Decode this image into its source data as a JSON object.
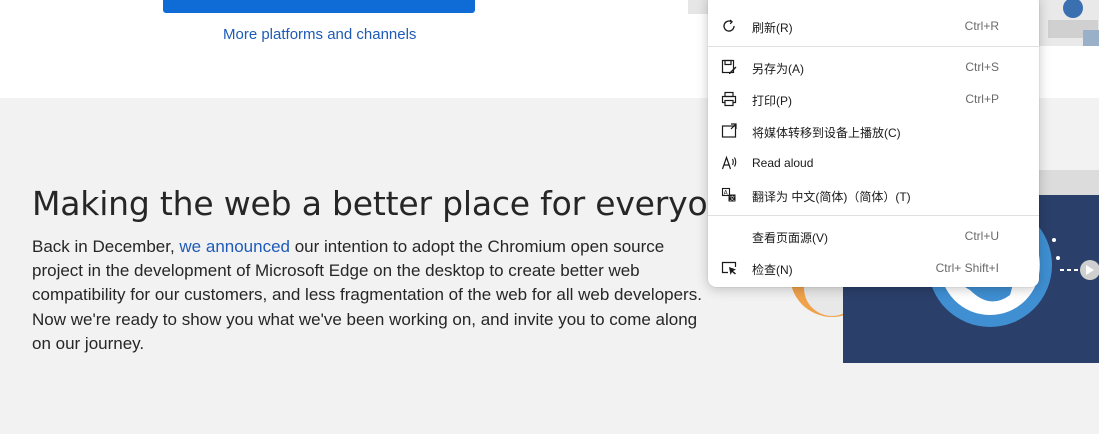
{
  "hero": {
    "more_link": "More platforms and channels"
  },
  "section": {
    "headline": "Making the web a better place for everyone",
    "body_before": "Back in December, ",
    "body_link": "we announced",
    "body_after": " our intention to adopt the Chromium open source project in the development of Microsoft Edge on the desktop to create better web compatibility for our customers, and less fragmentation of the web for all web developers. Now we're ready to show you what we've been working on, and invite you to come along on our journey."
  },
  "context_menu": {
    "items": [
      {
        "label": "刷新(R)",
        "shortcut": "Ctrl+R",
        "icon": "refresh-icon"
      },
      {
        "label": "另存为(A)",
        "shortcut": "Ctrl+S",
        "icon": "save-as-icon"
      },
      {
        "label": "打印(P)",
        "shortcut": "Ctrl+P",
        "icon": "print-icon"
      },
      {
        "label": "将媒体转移到设备上播放(C)",
        "shortcut": "",
        "icon": "cast-media-icon"
      },
      {
        "label": "Read aloud",
        "shortcut": "",
        "icon": "read-aloud-icon"
      },
      {
        "label": "翻译为 中文(简体)（简体）(T)",
        "shortcut": "",
        "icon": "translate-icon"
      },
      {
        "label": "查看页面源(V)",
        "shortcut": "Ctrl+U",
        "icon": ""
      },
      {
        "label": "检查(N)",
        "shortcut": "Ctrl+ Shift+I",
        "icon": "inspect-icon"
      }
    ]
  },
  "colors": {
    "accent": "#0f6cd6",
    "link": "#1e5bb8",
    "section_bg": "#f2f2f2"
  }
}
